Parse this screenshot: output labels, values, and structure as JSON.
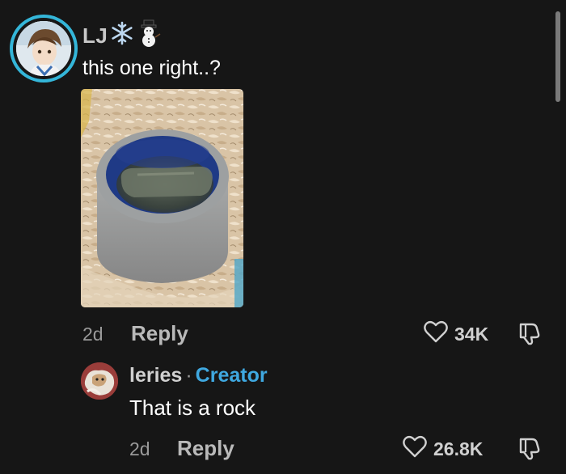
{
  "comment": {
    "username": "LJ",
    "username_emojis": [
      "snowflake",
      "snowman"
    ],
    "text": "this one right..?",
    "age": "2d",
    "reply_label": "Reply",
    "like_count": "34K"
  },
  "reply_comment": {
    "username": "leries",
    "separator": "·",
    "badge": "Creator",
    "text": "That is a rock",
    "age": "2d",
    "reply_label": "Reply",
    "like_count": "26.8K"
  },
  "colors": {
    "background": "#161616",
    "avatar_ring": "#34b6d9",
    "creator_badge": "#3fa8e0"
  },
  "icons": [
    "heart-outline-icon",
    "dislike-icon"
  ]
}
